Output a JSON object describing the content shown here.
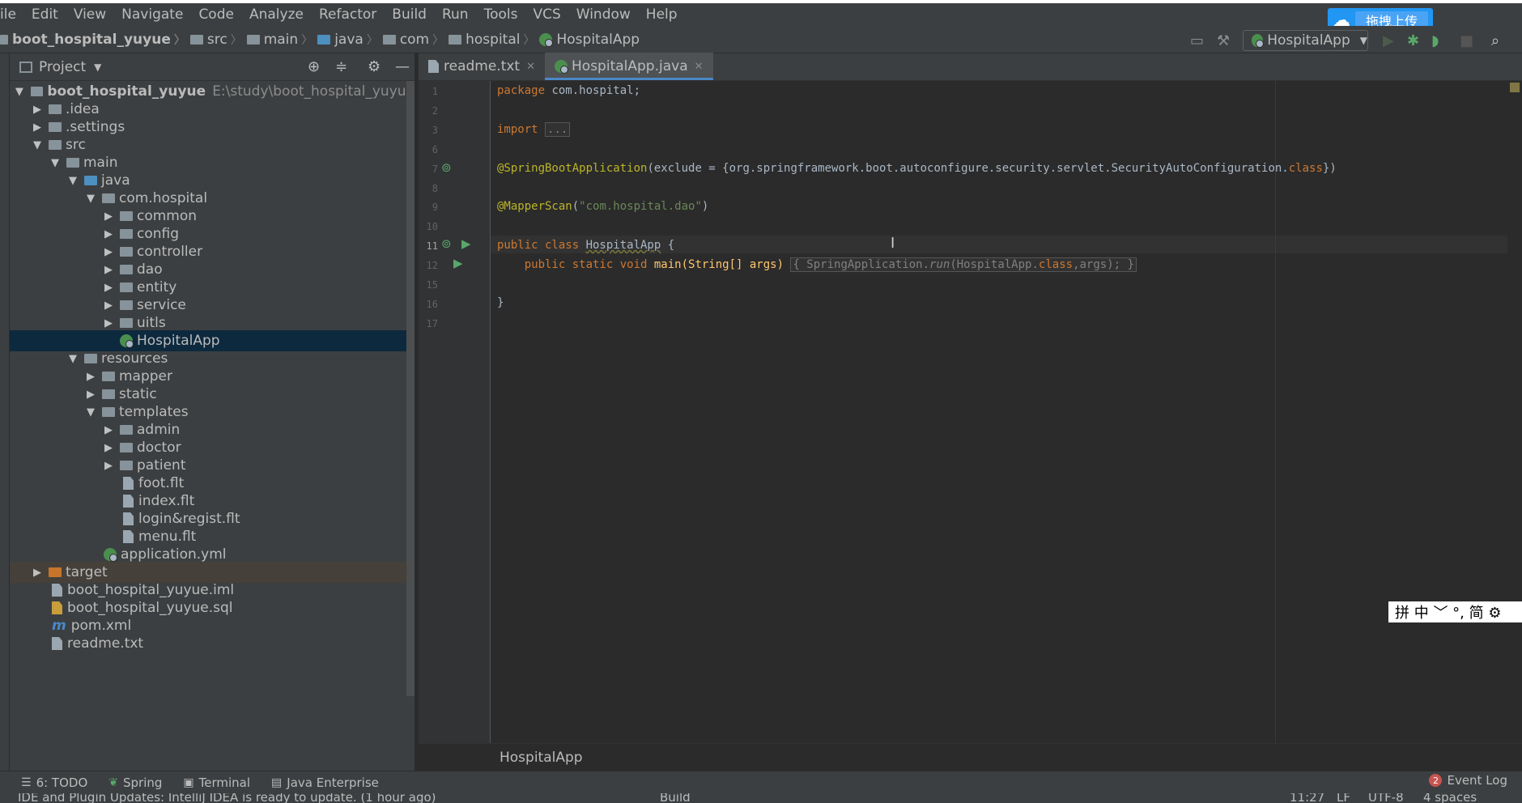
{
  "menu": [
    "ile",
    "Edit",
    "View",
    "Navigate",
    "Code",
    "Analyze",
    "Refactor",
    "Build",
    "Run",
    "Tools",
    "VCS",
    "Window",
    "Help"
  ],
  "baidu": {
    "label": "拖拽上传"
  },
  "breadcrumb": [
    "boot_hospital_yuyue",
    "src",
    "main",
    "java",
    "com",
    "hospital",
    "HospitalApp"
  ],
  "run_config": "HospitalApp",
  "project_panel": {
    "title": "Project"
  },
  "tree": {
    "root_name": "boot_hospital_yuyue",
    "root_path": "E:\\study\\boot_hospital_yuyue",
    "idea": ".idea",
    "settings": ".settings",
    "src": "src",
    "main": "main",
    "java": "java",
    "com_hospital": "com.hospital",
    "common": "common",
    "config": "config",
    "controller": "controller",
    "dao": "dao",
    "entity": "entity",
    "service": "service",
    "uitls": "uitls",
    "hospitalapp": "HospitalApp",
    "resources": "resources",
    "mapper": "mapper",
    "static": "static",
    "templates": "templates",
    "admin": "admin",
    "doctor": "doctor",
    "patient": "patient",
    "foot": "foot.flt",
    "index": "index.flt",
    "login": "login&regist.flt",
    "menu_flt": "menu.flt",
    "application": "application.yml",
    "target": "target",
    "iml": "boot_hospital_yuyue.iml",
    "sql": "boot_hospital_yuyue.sql",
    "pom": "pom.xml",
    "readme": "readme.txt"
  },
  "tabs": {
    "readme": "readme.txt",
    "hospitalapp": "HospitalApp.java"
  },
  "code": {
    "l1_kw": "package",
    "l1_rest": " com.hospital;",
    "l3_kw": "import",
    "l3_fold": "...",
    "l7_ann": "@SpringBootApplication",
    "l7_a": "(exclude = {org.springframework.boot.autoconfigure.security.servlet.SecurityAutoConfiguration.",
    "l7_kw": "class",
    "l7_b": "})",
    "l9_ann": "@MapperScan",
    "l9_a": "(",
    "l9_str": "\"com.hospital.dao\"",
    "l9_b": ")",
    "l11_kw": "public class ",
    "l11_name": "HospitalApp",
    "l11_b": " {",
    "l12_kw": "    public static void ",
    "l12_a": "main(String[] args) ",
    "l12_fold": "{ SpringApplication.",
    "l12_it": "run",
    "l12_b": "(HospitalApp.",
    "l12_kw2": "class",
    "l12_c": ",args); }",
    "l16": "}"
  },
  "line_numbers": [
    "1",
    "2",
    "3",
    "6",
    "7",
    "8",
    "9",
    "10",
    "11",
    "12",
    "15",
    "16",
    "17"
  ],
  "editor_breadcrumb": "HospitalApp",
  "tool_windows": {
    "todo": "6: TODO",
    "spring": "Spring",
    "terminal": "Terminal",
    "java_ee": "Java Enterprise",
    "event_log": "Event Log",
    "event_count": "2"
  },
  "status": {
    "message": "IDE and Plugin Updates: IntelliJ IDEA is ready to update. (1 hour ago)",
    "build": "Build",
    "position": "11:27",
    "lf": "LF",
    "encoding": "UTF-8",
    "indent": "4 spaces"
  },
  "ime": {
    "chars": "拼 中 ﹀ °, 简 ⚙"
  }
}
